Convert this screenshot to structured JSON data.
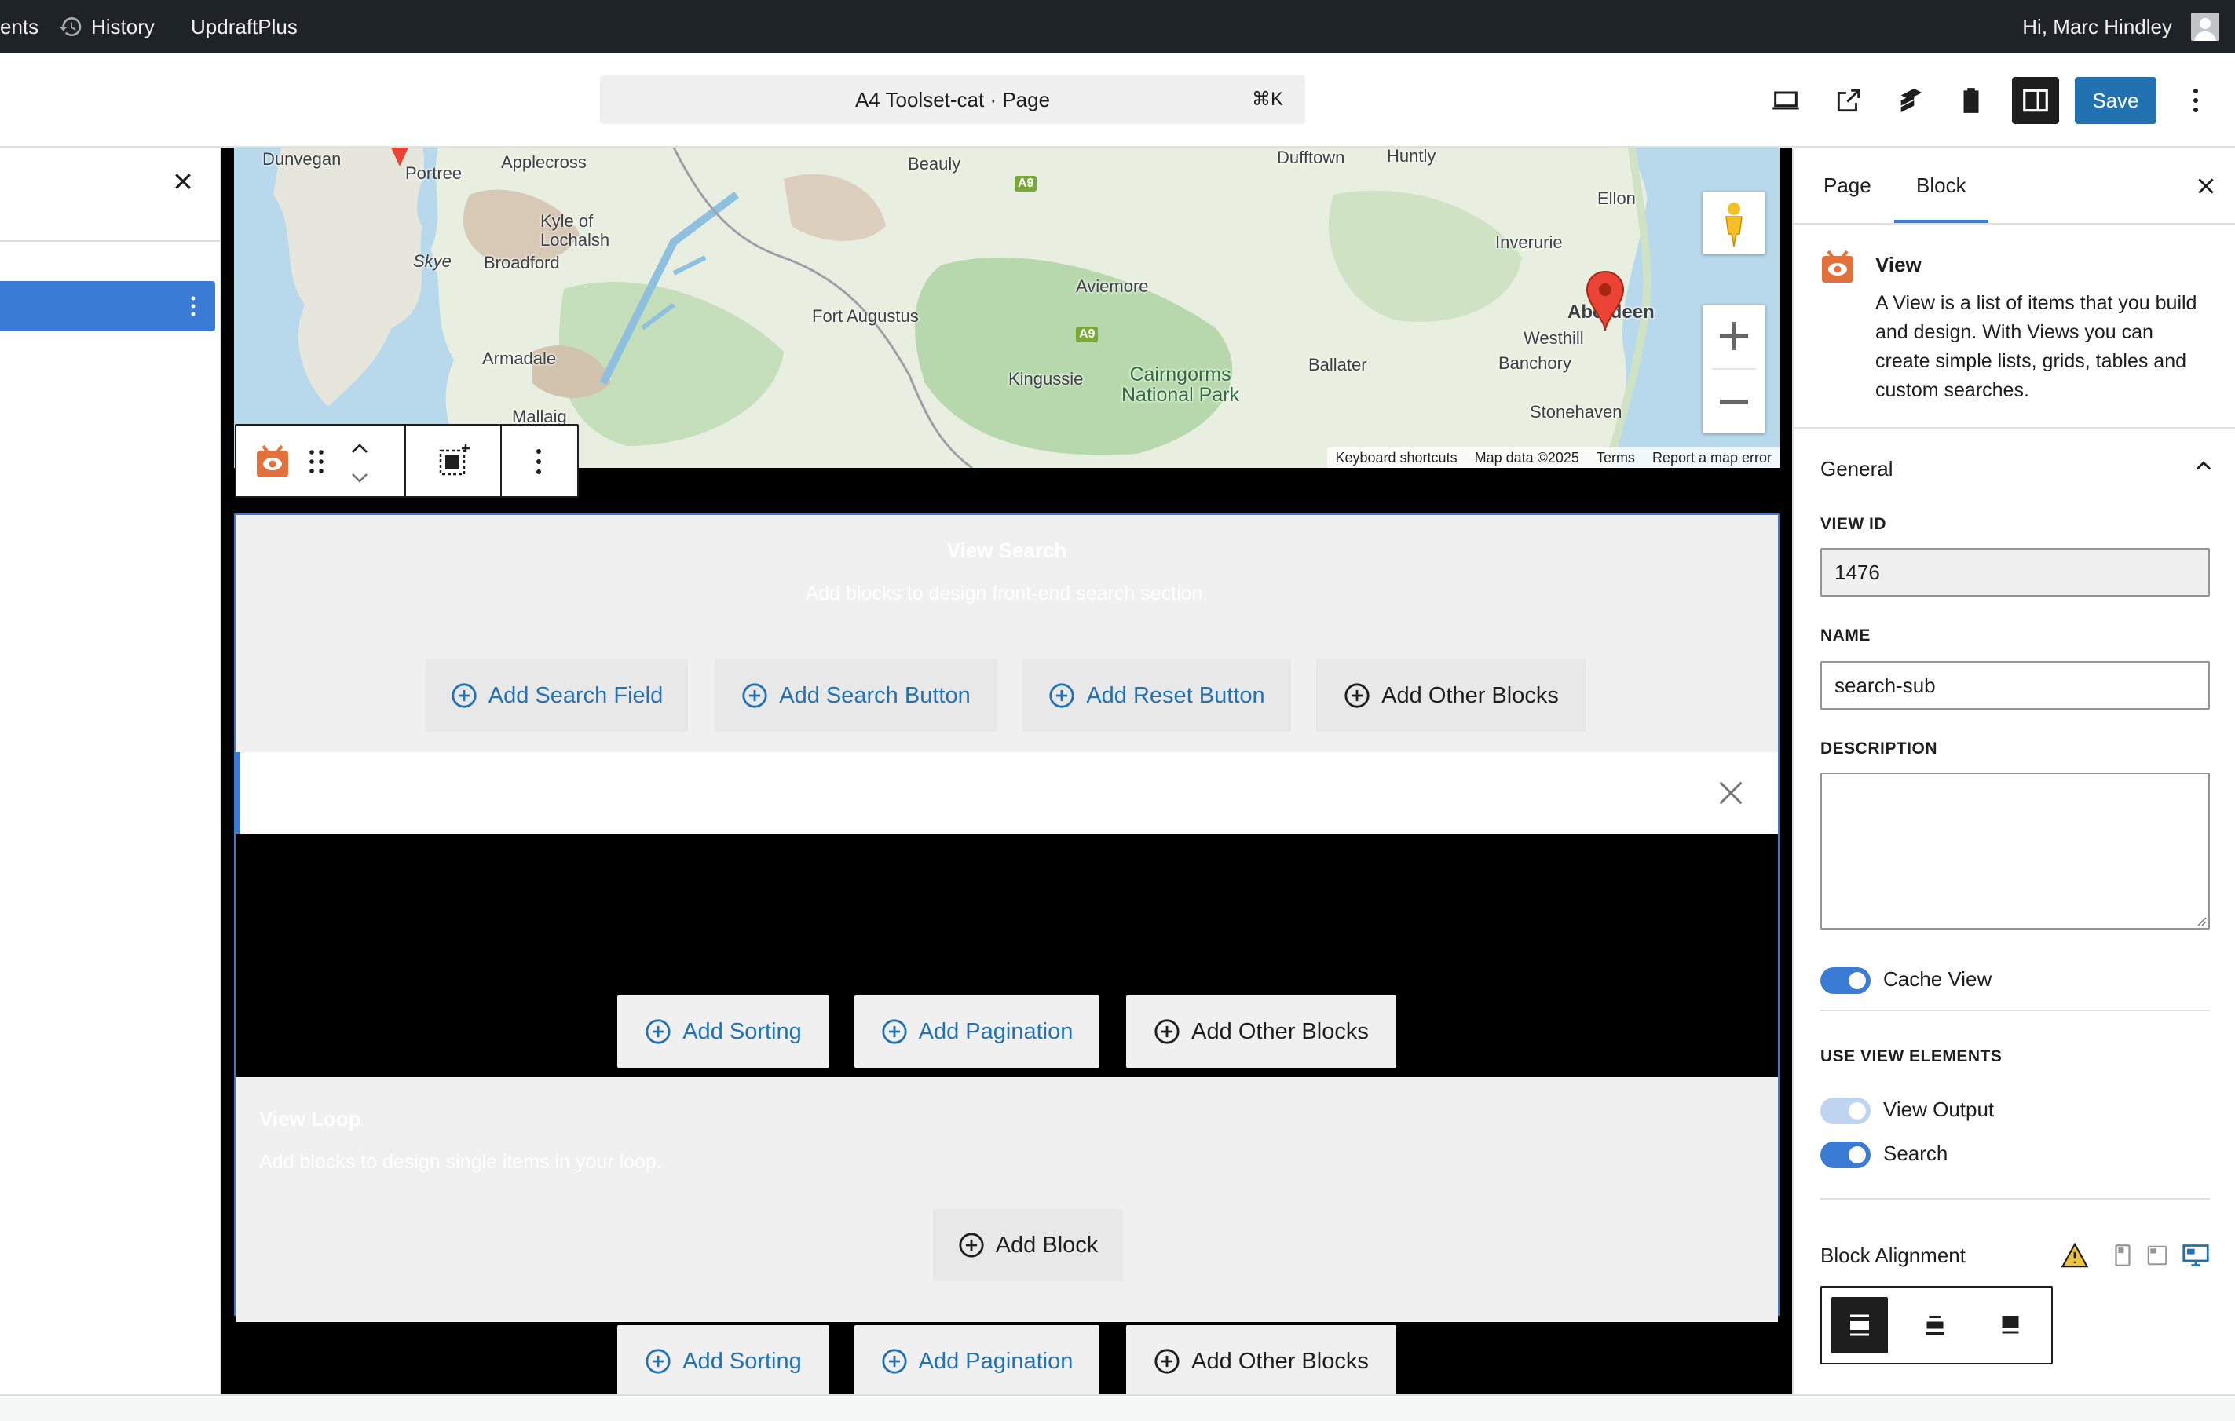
{
  "admin_bar": {
    "items": [
      "ents",
      "History",
      "UpdraftPlus"
    ],
    "greeting": "Hi, Marc Hindley"
  },
  "header": {
    "document_title": "A4 Toolset-cat · Page",
    "shortcut": "⌘K",
    "save_label": "Save"
  },
  "map": {
    "labels": {
      "dunvegan": "Dunvegan",
      "portree": "Portree",
      "applecross": "Applecross",
      "beauly": "Beauly",
      "dufftown": "Dufftown",
      "huntly": "Huntly",
      "ellon": "Ellon",
      "kyle": "Kyle of\nLochalsh",
      "skye": "Skye",
      "broadford": "Broadford",
      "inverurie": "Inverurie",
      "aviemore": "Aviemore",
      "fort_augustus": "Fort Augustus",
      "aberdeen": "Aberdeen",
      "westhill": "Westhill",
      "armadale": "Armadale",
      "kingussie": "Kingussie",
      "cairngorms": "Cairngorms\nNational Park",
      "ballater": "Ballater",
      "banchory": "Banchory",
      "stonehaven": "Stonehaven",
      "mallaig": "Mallaig",
      "road1": "A9",
      "road2": "A9"
    },
    "footer": [
      "Keyboard shortcuts",
      "Map data ©2025",
      "Terms",
      "Report a map error"
    ]
  },
  "view_block": {
    "search_section": {
      "title": "View Search",
      "subtitle": "Add blocks to design front-end search section.",
      "buttons": [
        "Add Search Field",
        "Add Search Button",
        "Add Reset Button",
        "Add Other Blocks"
      ]
    },
    "controls_top": [
      "Add Sorting",
      "Add Pagination",
      "Add Other Blocks"
    ],
    "loop_section": {
      "title": "View Loop",
      "subtitle": "Add blocks to design single items in your loop.",
      "add_block": "Add Block"
    },
    "controls_bottom": [
      "Add Sorting",
      "Add Pagination",
      "Add Other Blocks"
    ]
  },
  "sidebar": {
    "tabs": [
      "Page",
      "Block"
    ],
    "block_card": {
      "title": "View",
      "description": "A View is a list of items that you build and design. With Views you can create simple lists, grids, tables and custom searches."
    },
    "general_panel": {
      "title": "General",
      "view_id_label": "VIEW ID",
      "view_id_value": "1476",
      "name_label": "NAME",
      "name_value": "search-sub",
      "description_label": "DESCRIPTION",
      "description_value": "",
      "cache_view_label": "Cache View",
      "use_elements_label": "USE VIEW ELEMENTS",
      "view_output_label": "View Output",
      "search_label": "Search",
      "block_alignment_label": "Block Alignment"
    },
    "toggles": {
      "cache_view": true,
      "view_output": true,
      "search": true
    }
  },
  "colors": {
    "accent": "#3a7bd5",
    "wp_blue": "#2271b1",
    "dark": "#1e1e1e",
    "toolset_orange": "#e2713c"
  }
}
